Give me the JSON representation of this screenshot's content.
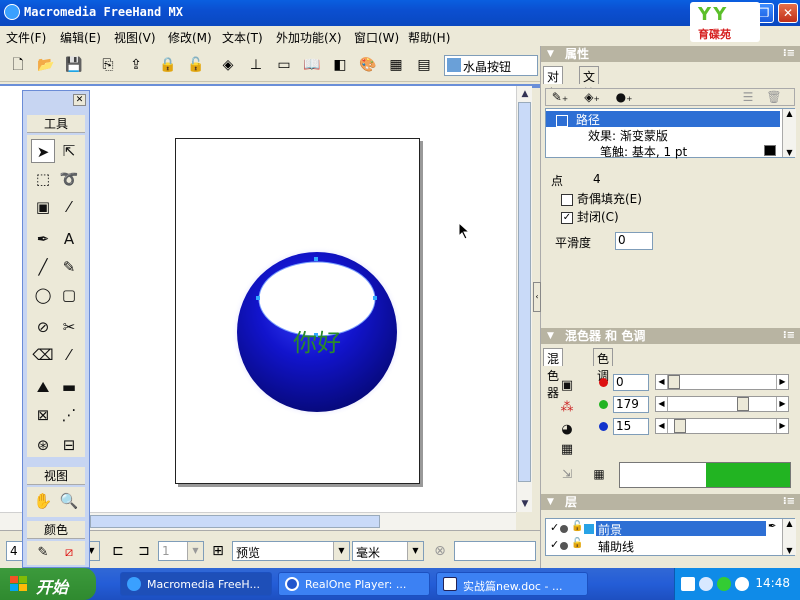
{
  "window": {
    "title": "Macromedia FreeHand MX",
    "logo_text": "育碟苑",
    "minimize": "_",
    "maximize": "❐",
    "close": "✕"
  },
  "menu": [
    "文件(F)",
    "编辑(E)",
    "视图(V)",
    "修改(M)",
    "文本(T)",
    "外加功能(X)",
    "窗口(W)",
    "帮助(H)"
  ],
  "toolbar": {
    "style_combo": "水晶按钮"
  },
  "tools_panel": {
    "close": "✕",
    "tools_header": "工具",
    "view_header": "视图",
    "color_header": "颜色"
  },
  "artwork": {
    "text": "你好",
    "colors": {
      "sphere": "#0a0cb4",
      "text": "#2a8a2a"
    }
  },
  "statusbar": {
    "zoom": "4",
    "page": "1",
    "view_mode": "预览",
    "units": "毫米"
  },
  "properties_panel": {
    "title": "属性",
    "tabs": [
      "对象",
      "文档"
    ],
    "items": [
      {
        "label": "路径",
        "selected": true
      },
      {
        "label": "效果: 渐变蒙版",
        "selected": false
      },
      {
        "label": "笔触: 基本, 1 pt",
        "selected": false
      }
    ],
    "points_label": "点",
    "points_value": "4",
    "even_odd_fill": "奇偶填充(E)",
    "closed": "封闭(C)",
    "smoothness_label": "平滑度",
    "smoothness_value": "0"
  },
  "mixer_panel": {
    "title": "混色器 和 色调",
    "tabs": [
      "混色器",
      "色调"
    ],
    "channels": [
      {
        "color": "#dd1111",
        "value": "0",
        "level": 0.0
      },
      {
        "color": "#22b422",
        "value": "179",
        "level": 0.7
      },
      {
        "color": "#1133cc",
        "value": "15",
        "level": 0.06
      }
    ],
    "preview_new": "#22b422"
  },
  "layers_panel": {
    "title": "层",
    "layers": [
      {
        "name": "前景",
        "selected": true
      },
      {
        "name": "辅助线",
        "selected": false
      }
    ]
  },
  "taskbar": {
    "start": "开始",
    "tasks": [
      {
        "label": "Macromedia FreeH...",
        "active": true
      },
      {
        "label": "RealOne Player: ...",
        "active": false
      },
      {
        "label": "实战篇new.doc - ...",
        "active": false
      }
    ],
    "clock": "14:48"
  }
}
